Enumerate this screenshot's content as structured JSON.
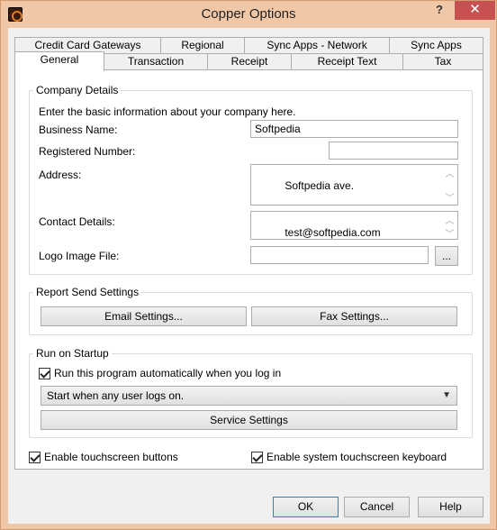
{
  "window": {
    "title": "Copper Options",
    "help_glyph": "?",
    "close_glyph": "✕"
  },
  "tabs": {
    "row1": [
      "Credit Card Gateways",
      "Regional",
      "Sync Apps - Network",
      "Sync Apps"
    ],
    "row2": [
      "General",
      "Transaction",
      "Receipt",
      "Receipt Text",
      "Tax"
    ]
  },
  "company": {
    "title": "Company Details",
    "intro": "Enter the basic information about your company here.",
    "business_name_label": "Business Name:",
    "business_name_value": "Softpedia",
    "registered_number_label": "Registered Number:",
    "registered_number_value": "",
    "address_label": "Address:",
    "address_value": "Softpedia ave.",
    "contact_label": "Contact Details:",
    "contact_value": "test@softpedia.com",
    "logo_label": "Logo Image File:",
    "logo_value": "",
    "browse_label": "..."
  },
  "report": {
    "title": "Report Send Settings",
    "email_button": "Email Settings...",
    "fax_button": "Fax Settings..."
  },
  "startup": {
    "title": "Run on Startup",
    "autorun_label": "Run this program automatically when you log in",
    "autorun_checked": true,
    "mode_value": "Start when any user logs on.",
    "service_button": "Service Settings"
  },
  "options": {
    "touch_buttons_label": "Enable touchscreen buttons",
    "touch_buttons_checked": true,
    "touch_keyboard_label": "Enable system touchscreen keyboard",
    "touch_keyboard_checked": true
  },
  "footer": {
    "ok": "OK",
    "cancel": "Cancel",
    "help": "Help"
  },
  "icons": {
    "scroll_up": "︿",
    "scroll_down": "﹀",
    "dropdown": "▼"
  }
}
